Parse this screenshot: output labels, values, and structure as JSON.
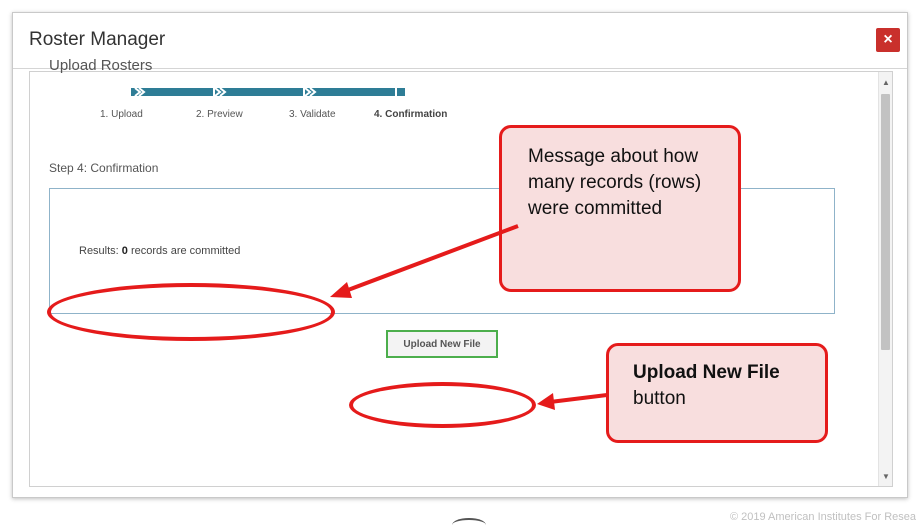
{
  "modal": {
    "title": "Roster Manager",
    "close_label": "×"
  },
  "wizard": {
    "section_title": "Upload Rosters",
    "steps": [
      {
        "label": "1. Upload",
        "active": false
      },
      {
        "label": "2. Preview",
        "active": false
      },
      {
        "label": "3. Validate",
        "active": false
      },
      {
        "label": "4. Confirmation",
        "active": true
      }
    ],
    "step_heading": "Step 4: Confirmation",
    "results_prefix": "Results: ",
    "results_count": "0",
    "results_suffix": " records are committed",
    "upload_button_label": "Upload New File",
    "progress": 1.0
  },
  "annotations": {
    "message_callout": "Message about how many records (rows) were committed",
    "upload_callout_bold": "Upload New File",
    "upload_callout_rest": " button"
  },
  "footer": {
    "copyright": "© 2019 American Institutes For Resea"
  },
  "colors": {
    "accent_blue": "#2e7d96",
    "close_red": "#c9302c",
    "annotation_red": "#e51b1b",
    "annotation_fill": "#f8dede",
    "button_border_green": "#4cae4c"
  }
}
